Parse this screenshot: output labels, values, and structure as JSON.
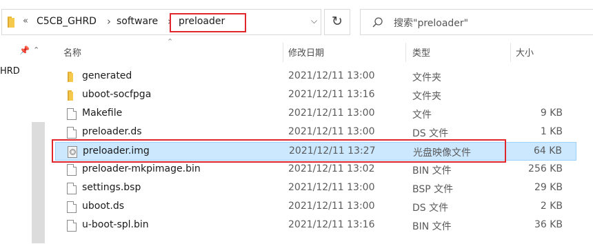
{
  "address_bar": {
    "overflow": "«",
    "crumbs": [
      "C5CB_GHRD",
      "software",
      "preloader"
    ],
    "refresh_glyph": "↻",
    "dropdown_glyph": "⌵"
  },
  "search": {
    "placeholder": "搜索\"preloader\""
  },
  "nav_pane": {
    "partial_label": "HRD"
  },
  "columns": {
    "name": "名称",
    "date": "修改日期",
    "type": "类型",
    "size": "大小"
  },
  "files": [
    {
      "name": "generated",
      "date": "2021/12/11 13:00",
      "type": "文件夹",
      "size": "",
      "icon": "folder-icon"
    },
    {
      "name": "uboot-socfpga",
      "date": "2021/12/11 13:16",
      "type": "文件夹",
      "size": "",
      "icon": "folder-icon"
    },
    {
      "name": "Makefile",
      "date": "2021/12/11 13:00",
      "type": "文件",
      "size": "9 KB",
      "icon": "file-icon"
    },
    {
      "name": "preloader.ds",
      "date": "2021/12/11 13:00",
      "type": "DS 文件",
      "size": "1 KB",
      "icon": "file-icon"
    },
    {
      "name": "preloader.img",
      "date": "2021/12/11 13:27",
      "type": "光盘映像文件",
      "size": "64 KB",
      "icon": "disc-image-icon",
      "selected": true
    },
    {
      "name": "preloader-mkpimage.bin",
      "date": "2021/12/11 13:02",
      "type": "BIN 文件",
      "size": "256 KB",
      "icon": "file-icon"
    },
    {
      "name": "settings.bsp",
      "date": "2021/12/11 13:00",
      "type": "BSP 文件",
      "size": "29 KB",
      "icon": "file-icon"
    },
    {
      "name": "uboot.ds",
      "date": "2021/12/11 13:00",
      "type": "DS 文件",
      "size": "2 KB",
      "icon": "file-icon"
    },
    {
      "name": "u-boot-spl.bin",
      "date": "2021/12/11 13:16",
      "type": "BIN 文件",
      "size": "36 KB",
      "icon": "file-icon"
    }
  ],
  "colors": {
    "highlight_box": "#e0262c",
    "selection_bg": "#cce8ff",
    "selection_border": "#99d1ff",
    "folder": "#f5c94c"
  }
}
